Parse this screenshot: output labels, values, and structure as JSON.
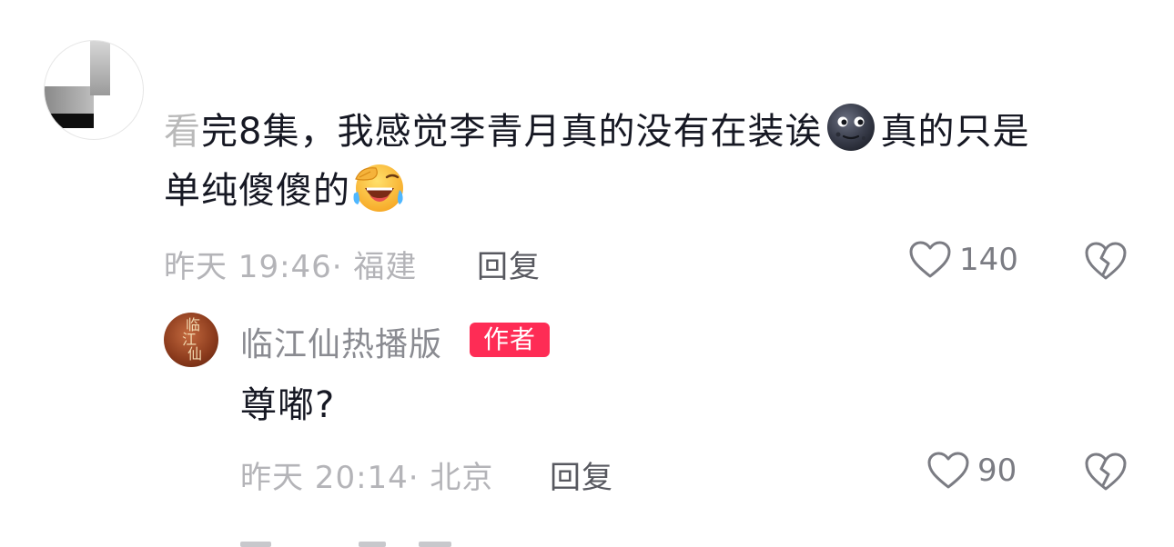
{
  "comment": {
    "text_faded": "看",
    "text_part1": "完8集，我感觉李青月真的没有在装诶",
    "emoji1": "new-moon-face",
    "text_part2": "真的只是",
    "text_line2": "单纯傻傻的",
    "emoji2": "laughing-tears-face",
    "meta": "昨天 19:46· 福建",
    "reply_label": "回复",
    "likes": "140"
  },
  "reply": {
    "avatar_text": "临江仙",
    "username": "临江仙热播版",
    "badge": "作者",
    "text": "尊嘟?",
    "meta": "昨天 20:14· 北京",
    "reply_label": "回复",
    "likes": "90"
  },
  "colors": {
    "text": "#161823",
    "meta": "#b4b4b8",
    "badge": "#fe2c55"
  }
}
